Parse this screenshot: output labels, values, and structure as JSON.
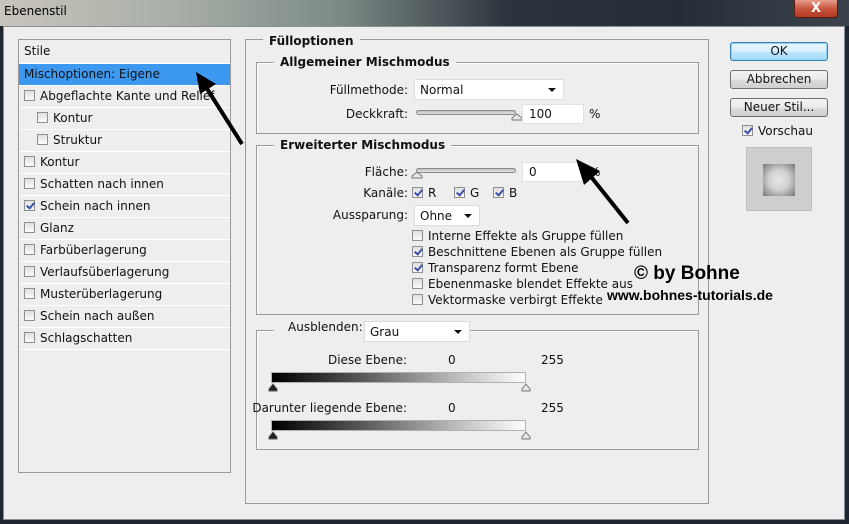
{
  "window": {
    "title": "Ebenenstil",
    "close_label": "X"
  },
  "styles_panel": {
    "header": "Stile",
    "items": [
      {
        "label": "Mischoptionen: Eigene",
        "selected": true,
        "checkbox": false
      },
      {
        "label": "Abgeflachte Kante und Relief",
        "checked": false
      },
      {
        "label": "Kontur",
        "checked": false,
        "indent": true
      },
      {
        "label": "Struktur",
        "checked": false,
        "indent": true
      },
      {
        "label": "Kontur",
        "checked": false
      },
      {
        "label": "Schatten nach innen",
        "checked": false
      },
      {
        "label": "Schein nach innen",
        "checked": true
      },
      {
        "label": "Glanz",
        "checked": false
      },
      {
        "label": "Farbüberlagerung",
        "checked": false
      },
      {
        "label": "Verlaufsüberlagerung",
        "checked": false
      },
      {
        "label": "Musterüberlagerung",
        "checked": false
      },
      {
        "label": "Schein nach außen",
        "checked": false
      },
      {
        "label": "Schlagschatten",
        "checked": false
      }
    ]
  },
  "fill_options": {
    "title": "Fülloptionen",
    "general": {
      "title": "Allgemeiner Mischmodus",
      "blend_mode_label": "Füllmethode:",
      "blend_mode_value": "Normal",
      "opacity_label": "Deckkraft:",
      "opacity_value": "100",
      "opacity_unit": "%",
      "opacity_fraction": 1.0
    },
    "advanced": {
      "title": "Erweiterter Mischmodus",
      "fill_label": "Fläche:",
      "fill_value": "0",
      "fill_unit": "%",
      "fill_fraction": 0.0,
      "channels_label": "Kanäle:",
      "channels": [
        {
          "label": "R",
          "checked": true
        },
        {
          "label": "G",
          "checked": true
        },
        {
          "label": "B",
          "checked": true
        }
      ],
      "knockout_label": "Aussparung:",
      "knockout_value": "Ohne",
      "options": [
        {
          "label": "Interne Effekte als Gruppe füllen",
          "checked": false
        },
        {
          "label": "Beschnittene Ebenen als Gruppe füllen",
          "checked": true
        },
        {
          "label": "Transparenz formt Ebene",
          "checked": true
        },
        {
          "label": "Ebenenmaske blendet Effekte aus",
          "checked": false
        },
        {
          "label": "Vektormaske verbirgt Effekte",
          "checked": false
        }
      ]
    },
    "blend_if": {
      "label": "Ausblenden:",
      "value": "Grau",
      "this_layer_label": "Diese Ebene:",
      "this_layer_min": "0",
      "this_layer_max": "255",
      "underlying_label": "Darunter liegende Ebene:",
      "underlying_min": "0",
      "underlying_max": "255"
    }
  },
  "buttons": {
    "ok": "OK",
    "cancel": "Abbrechen",
    "new_style": "Neuer Stil...",
    "preview_label": "Vorschau",
    "preview_checked": true
  },
  "watermark": {
    "line1": "© by Bohne",
    "line2": "www.bohnes-tutorials.de"
  }
}
